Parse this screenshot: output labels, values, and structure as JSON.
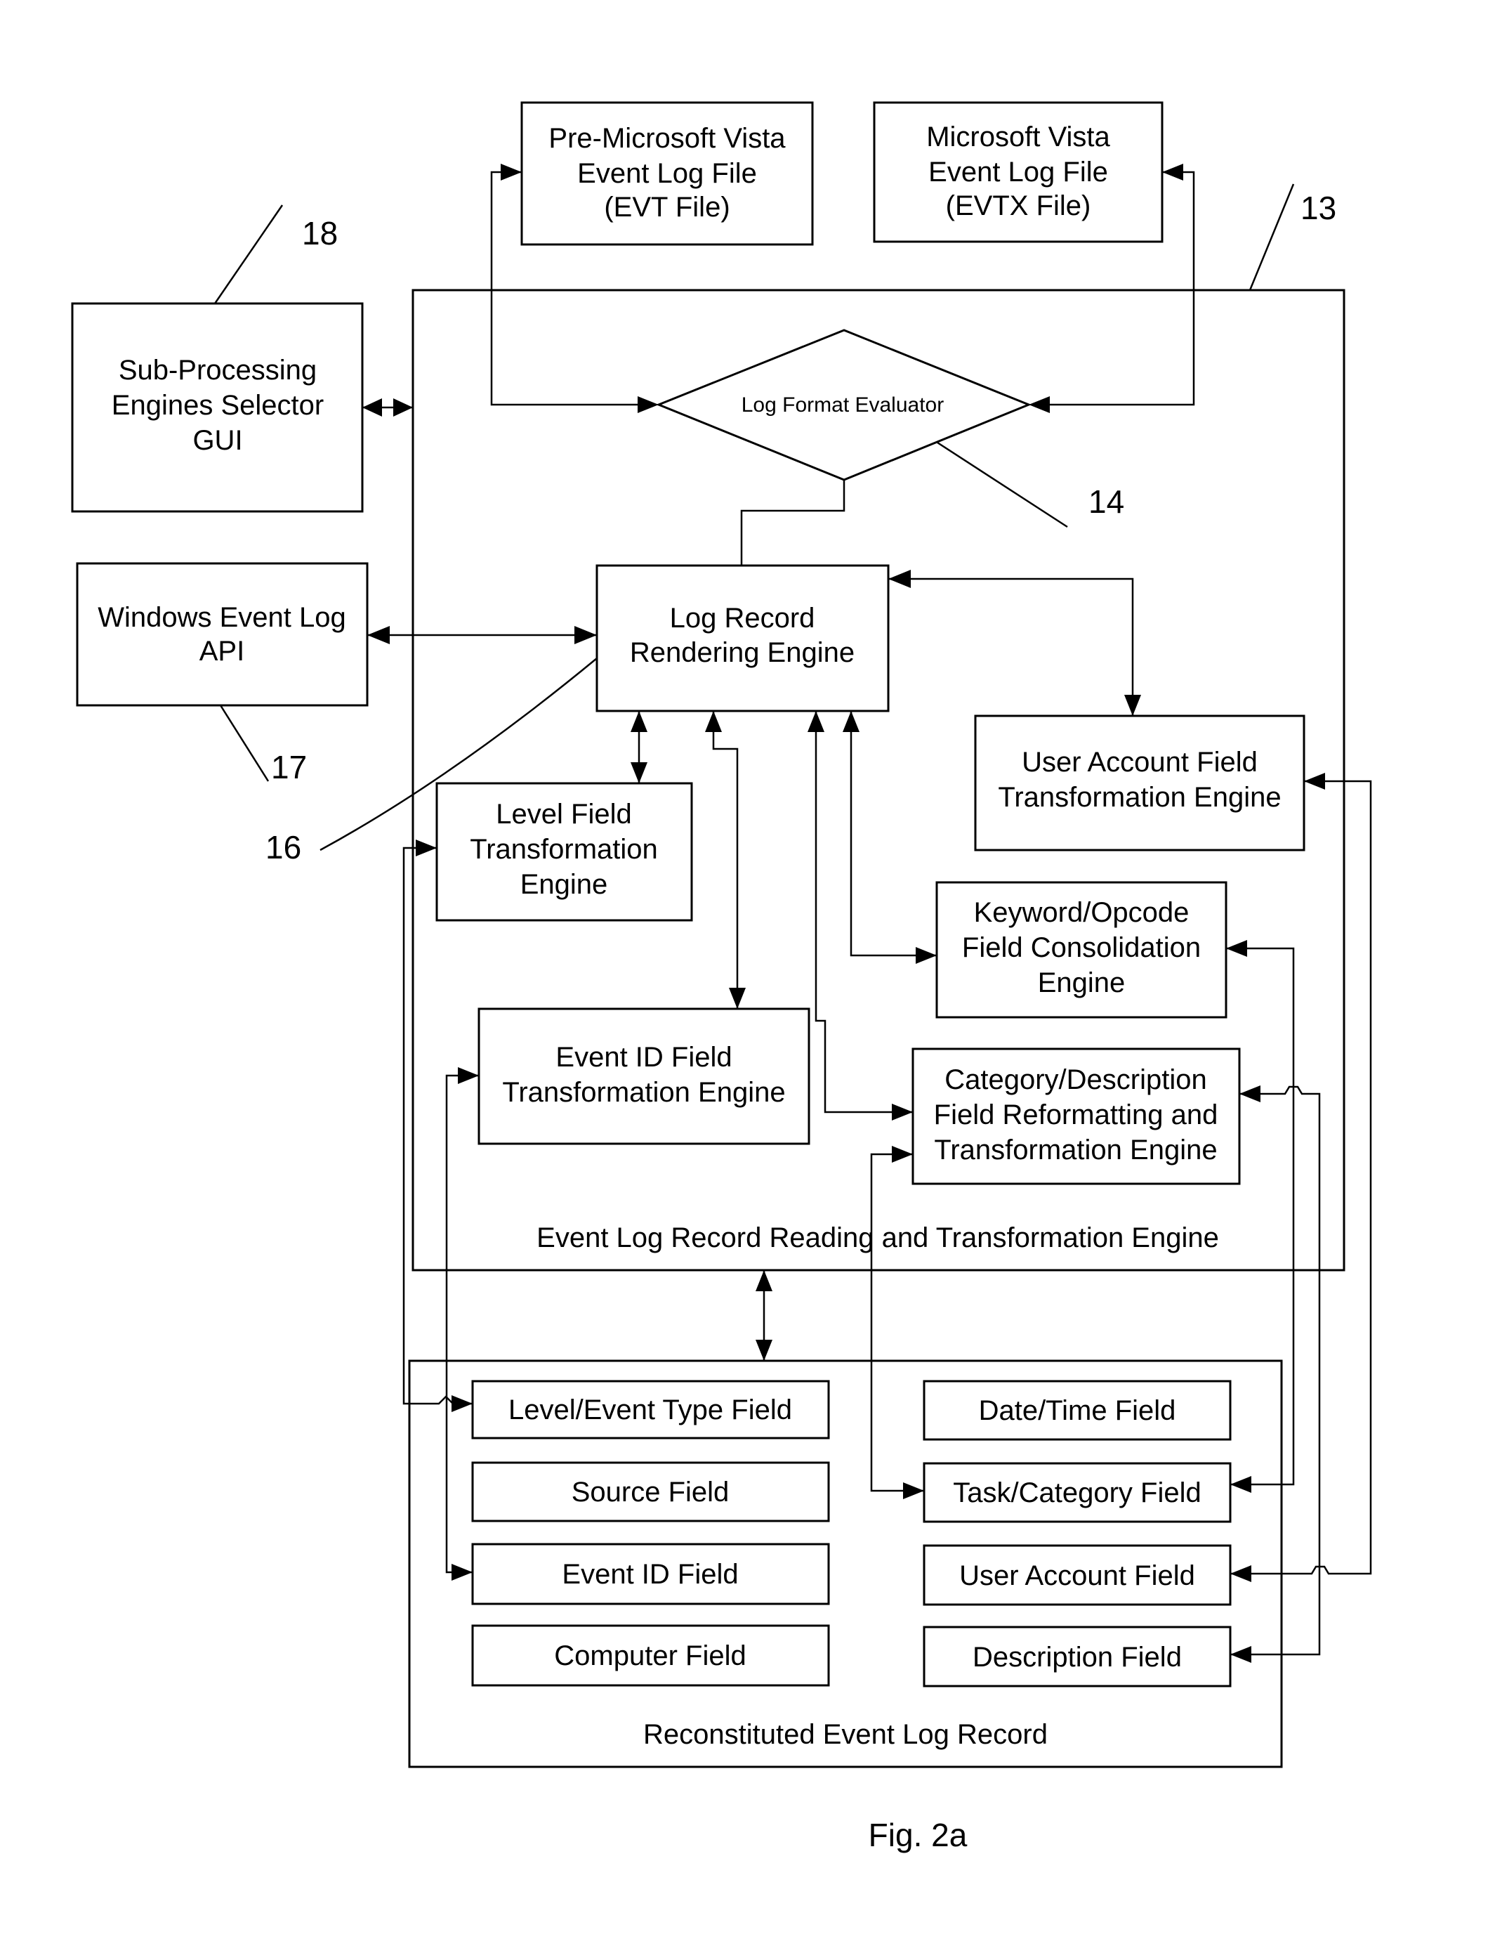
{
  "figure": {
    "caption": "Fig. 2a",
    "colors": {
      "line": "#000000",
      "background": "#ffffff"
    }
  },
  "sources": {
    "pre_vista": [
      "Pre-Microsoft Vista",
      "Event Log File",
      "(EVT File)"
    ],
    "vista": [
      "Microsoft Vista",
      "Event Log File",
      "(EVTX File)"
    ]
  },
  "external": {
    "selector_gui": [
      "Sub-Processing",
      "Engines Selector",
      "GUI"
    ],
    "windows_api": [
      "Windows Event Log",
      "API"
    ]
  },
  "engine": {
    "title": "Event Log Record Reading  and Transformation Engine",
    "evaluator": "Log Format Evaluator",
    "rendering": [
      "Log Record",
      "Rendering Engine"
    ],
    "level_transform": [
      "Level Field",
      "Transformation",
      "Engine"
    ],
    "user_account_transform": [
      "User Account Field",
      "Transformation Engine"
    ],
    "keyword_opcode": [
      "Keyword/Opcode",
      "Field Consolidation",
      "Engine"
    ],
    "event_id_transform": [
      "Event ID Field",
      "Transformation Engine"
    ],
    "category_description": [
      "Category/Description",
      "Field Reformatting and",
      "Transformation Engine"
    ]
  },
  "record": {
    "title": "Reconstituted Event Log Record",
    "fields_left": [
      "Level/Event Type Field",
      "Source Field",
      "Event ID Field",
      "Computer Field"
    ],
    "fields_right": [
      "Date/Time Field",
      "Task/Category Field",
      "User Account Field",
      "Description Field"
    ]
  },
  "refs": {
    "engine": "13",
    "evaluator": "14",
    "rendering": "16",
    "windows_api": "17",
    "selector_gui": "18"
  }
}
